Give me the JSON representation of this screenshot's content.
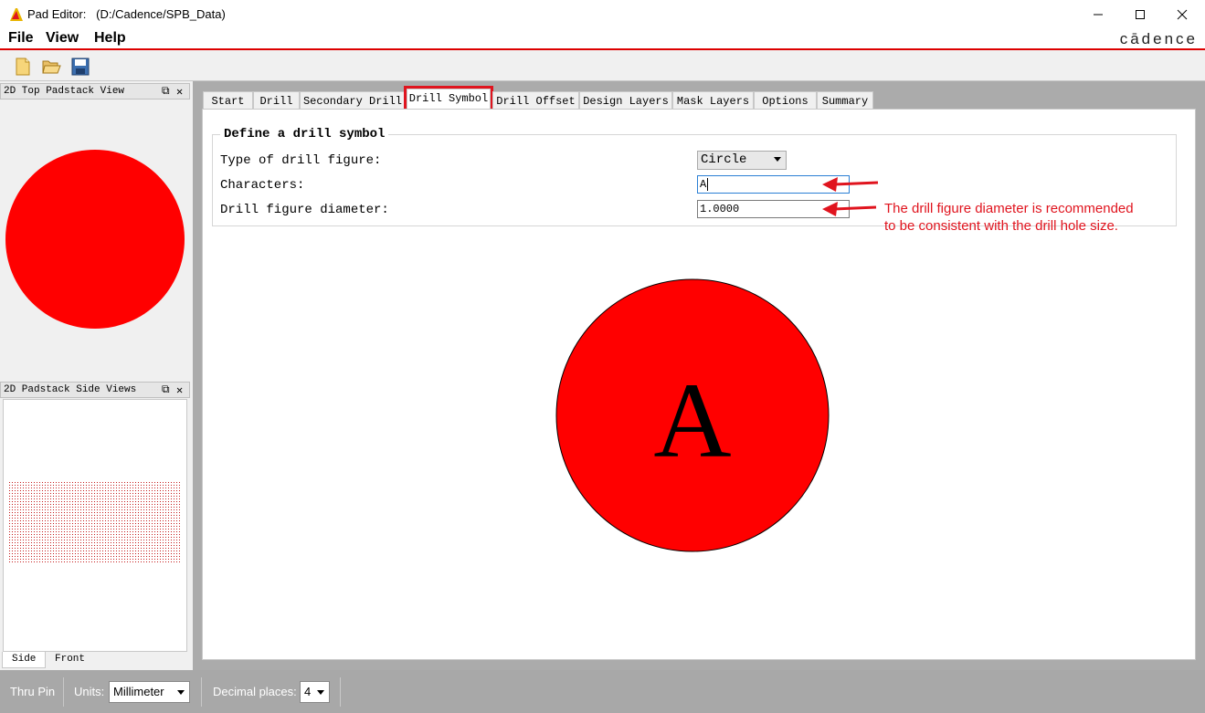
{
  "window": {
    "title_app": "Pad Editor:",
    "title_path": "(D:/Cadence/SPB_Data)",
    "brand": "cādence"
  },
  "menu": {
    "file": "File",
    "view": "View",
    "help": "Help"
  },
  "toolbar": {
    "new_icon": "new-file-icon",
    "open_icon": "open-folder-icon",
    "save_icon": "save-icon"
  },
  "left_panels": {
    "top_view_title": "2D Top Padstack View",
    "side_view_title": "2D Padstack Side Views",
    "subtabs": [
      "Side",
      "Front"
    ]
  },
  "tabs": [
    "Start",
    "Drill",
    "Secondary Drill",
    "Drill Symbol",
    "Drill Offset",
    "Design Layers",
    "Mask Layers",
    "Options",
    "Summary"
  ],
  "active_tab": "Drill Symbol",
  "drill_symbol": {
    "group_title": "Define a drill symbol",
    "type_label": "Type of drill figure:",
    "type_value": "Circle",
    "characters_label": "Characters:",
    "characters_value": "A",
    "diameter_label": "Drill figure diameter:",
    "diameter_value": "1.0000",
    "preview_char": "A"
  },
  "annotation": {
    "line1": "The drill figure diameter is recommended",
    "line2": "to be consistent with the drill hole size."
  },
  "statusbar": {
    "mode": "Thru Pin",
    "units_label": "Units:",
    "units_value": "Millimeter",
    "decimal_label": "Decimal places:",
    "decimal_value": "4"
  },
  "colors": {
    "pad_fill": "#ff0000",
    "accent_red": "#e0141e"
  }
}
